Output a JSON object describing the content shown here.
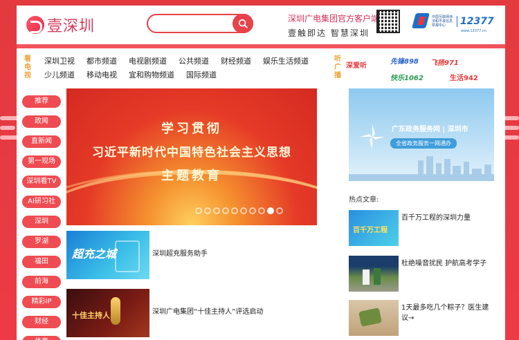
{
  "brand": {
    "logo_text": "壹深圳"
  },
  "search": {
    "placeholder": ""
  },
  "client": {
    "title": "深圳广电集团官方客户端",
    "subtitle": "壹触即达 智慧深圳"
  },
  "hotline": {
    "org": "中国互联网违法和不良信息举报中心",
    "number": "12377",
    "url": "www.12377.cn"
  },
  "nav": {
    "tv_tag": "看电视",
    "radio_tag": "听广播",
    "channels_row1": [
      "深圳卫视",
      "都市频道",
      "电视剧频道",
      "公共频道",
      "财经频道",
      "娱乐生活频道"
    ],
    "channels_row2": [
      "少儿频道",
      "移动电视",
      "宜和购物频道",
      "国际频道"
    ],
    "radios": {
      "shen_ting": "深爱听",
      "xianfeng": "先锋898",
      "feiyang": "飞扬971",
      "kuaile": "快乐1062",
      "shenghuo": "生活942"
    }
  },
  "side_menu": [
    "推荐",
    "政闻",
    "直新闻",
    "第一现场",
    "深圳看TV",
    "AI研习社",
    "深圳",
    "罗湖",
    "福田",
    "前海",
    "精彩IP",
    "财经",
    "体育"
  ],
  "banner": {
    "line1": "学习贯彻",
    "line2": "习近平新时代中国特色社会主义思想",
    "line3": "主题教育",
    "slide_count": 10,
    "active_slide": 9
  },
  "features": [
    {
      "thumb_label": "超充之城",
      "title": "深圳超充服务助手"
    },
    {
      "thumb_label": "十佳主持人",
      "title": "深圳广电集团“十佳主持人”评选启动"
    }
  ],
  "gov_ad": {
    "title": "广东政务服务网 | 深圳市",
    "subtitle": "全省政务服务一网通办"
  },
  "hot": {
    "title": "热点文章:",
    "items": [
      {
        "thumb_label": "百千万工程",
        "title": "百千万工程的深圳力量"
      },
      {
        "thumb_label": "",
        "title": "杜绝噪音扰民 护航高考学子"
      },
      {
        "thumb_label": "",
        "title": "1天最多吃几个粽子？医生建议→"
      }
    ]
  },
  "colors": {
    "brand_red": "#e8424b",
    "logo_pink": "#d83a5e",
    "tag_orange": "#f0a136"
  }
}
